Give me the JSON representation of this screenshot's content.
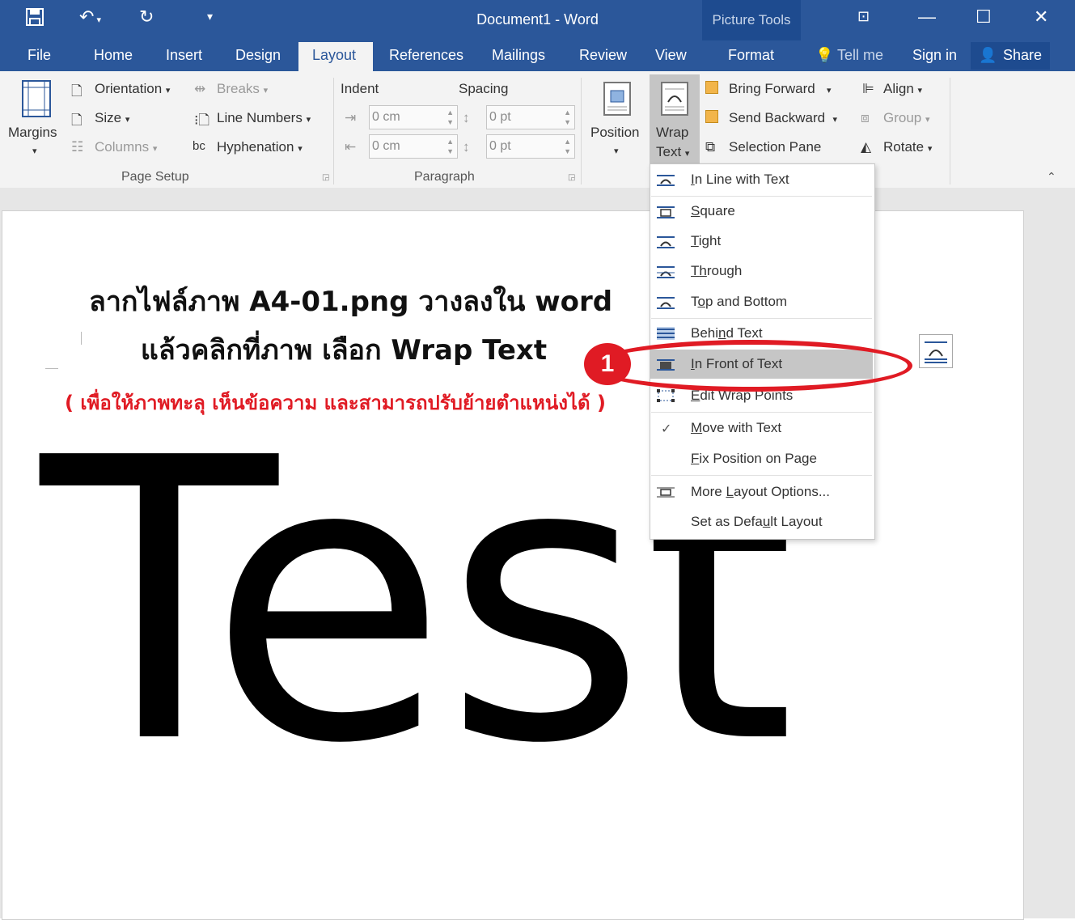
{
  "window": {
    "title": "Document1 - Word",
    "contextual_tab_group": "Picture Tools"
  },
  "tabs": [
    "File",
    "Home",
    "Insert",
    "Design",
    "Layout",
    "References",
    "Mailings",
    "Review",
    "View",
    "Format"
  ],
  "active_tab": "Layout",
  "tell_me": "Tell me",
  "sign_in": "Sign in",
  "share": "Share",
  "ribbon": {
    "page_setup": {
      "margins": "Margins",
      "orientation": "Orientation",
      "size": "Size",
      "columns": "Columns",
      "breaks": "Breaks",
      "line_numbers": "Line Numbers",
      "hyphenation": "Hyphenation",
      "label": "Page Setup"
    },
    "paragraph": {
      "indent": "Indent",
      "spacing": "Spacing",
      "indent_left": "0 cm",
      "indent_right": "0 cm",
      "spacing_before": "0 pt",
      "spacing_after": "0 pt",
      "label": "Paragraph"
    },
    "arrange": {
      "position": "Position",
      "wrap_text_1": "Wrap",
      "wrap_text_2": "Text",
      "bring_forward": "Bring Forward",
      "send_backward": "Send Backward",
      "selection_pane": "Selection Pane",
      "align": "Align",
      "group": "Group",
      "rotate": "Rotate"
    }
  },
  "wrap_menu": {
    "items": [
      "In Line with Text",
      "Square",
      "Tight",
      "Through",
      "Top and Bottom",
      "Behind Text",
      "In Front of Text",
      "Edit Wrap Points",
      "Move with Text",
      "Fix Position on Page",
      "More Layout Options...",
      "Set as Default Layout"
    ],
    "highlighted": "In Front of Text",
    "checked": "Move with Text"
  },
  "document": {
    "line1": "ลากไฟล์ภาพ A4-01.png วางลงใน word",
    "line2": "แล้วคลิกที่ภาพ เลือก Wrap Text",
    "line3": "( เพื่อให้ภาพทะลุ เห็นข้อความ และสามารถปรับย้ายตำแหน่งได้ )",
    "image_text": "Test"
  },
  "annotation": {
    "badge": "1",
    "color": "#e01b24"
  },
  "colors": {
    "titlebar": "#2b579a",
    "ribbon": "#f3f3f3",
    "accent_red": "#e01b24"
  }
}
